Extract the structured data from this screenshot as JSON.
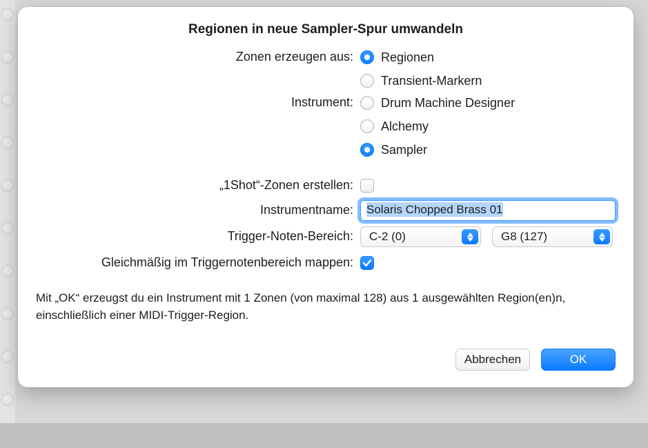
{
  "dialog": {
    "title": "Regionen in neue Sampler-Spur umwandeln"
  },
  "zones_from": {
    "label": "Zonen erzeugen aus:",
    "options": {
      "regions": "Regionen",
      "transient_markers": "Transient-Markern"
    },
    "selected": "regions"
  },
  "instrument": {
    "label": "Instrument:",
    "options": {
      "drum_machine_designer": "Drum Machine Designer",
      "alchemy": "Alchemy",
      "sampler": "Sampler"
    },
    "selected": "sampler"
  },
  "one_shot": {
    "label": "„1Shot“-Zonen erstellen:",
    "checked": false
  },
  "instrument_name": {
    "label": "Instrumentname:",
    "value": "Solaris Chopped Brass 01"
  },
  "trigger_range": {
    "label": "Trigger-Noten-Bereich:",
    "low": "C-2  (0)",
    "high": "G8   (127)"
  },
  "map_evenly": {
    "label": "Gleichmäßig im Triggernotenbereich mappen:",
    "checked": true
  },
  "note": "Mit „OK“ erzeugst du ein Instrument mit 1 Zonen (von maximal 128) aus 1 ausgewählten Region(en)n, einschließlich einer MIDI-Trigger-Region.",
  "buttons": {
    "cancel": "Abbrechen",
    "ok": "OK"
  }
}
